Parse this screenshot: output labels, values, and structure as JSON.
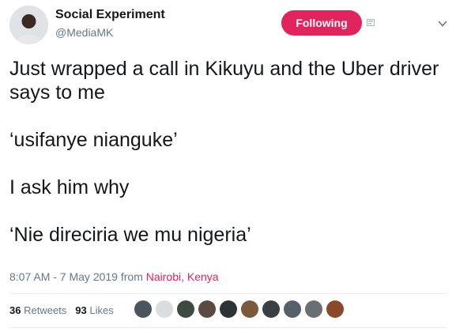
{
  "user": {
    "display_name": "Social Experiment",
    "handle": "@MediaMK"
  },
  "follow_button": {
    "label": "Following"
  },
  "tweet": {
    "lines": [
      "Just wrapped a call in Kikuyu and the Uber driver says to me",
      "‘usifanye nianguke’",
      "I ask him why",
      "‘Nie direciria we mu nigeria’"
    ]
  },
  "meta": {
    "timestamp": "8:07 AM - 7 May 2019",
    "from_label": "from",
    "location": "Nairobi, Kenya"
  },
  "stats": {
    "retweets_count": "36",
    "retweets_label": "Retweets",
    "likes_count": "93",
    "likes_label": "Likes"
  },
  "colors": {
    "accent": "#e0245e",
    "secondary_text": "#657786",
    "primary_text": "#14171a"
  },
  "icons": {
    "badge": "badge-icon",
    "caret": "chevron-down-icon"
  },
  "liker_avatar_colors": [
    "#4a5560",
    "#d9dde1",
    "#3d4a40",
    "#5a4a3f",
    "#2f3336",
    "#7a5a3a",
    "#3a3f44",
    "#55606b",
    "#6b6f73",
    "#8a4a2a"
  ]
}
